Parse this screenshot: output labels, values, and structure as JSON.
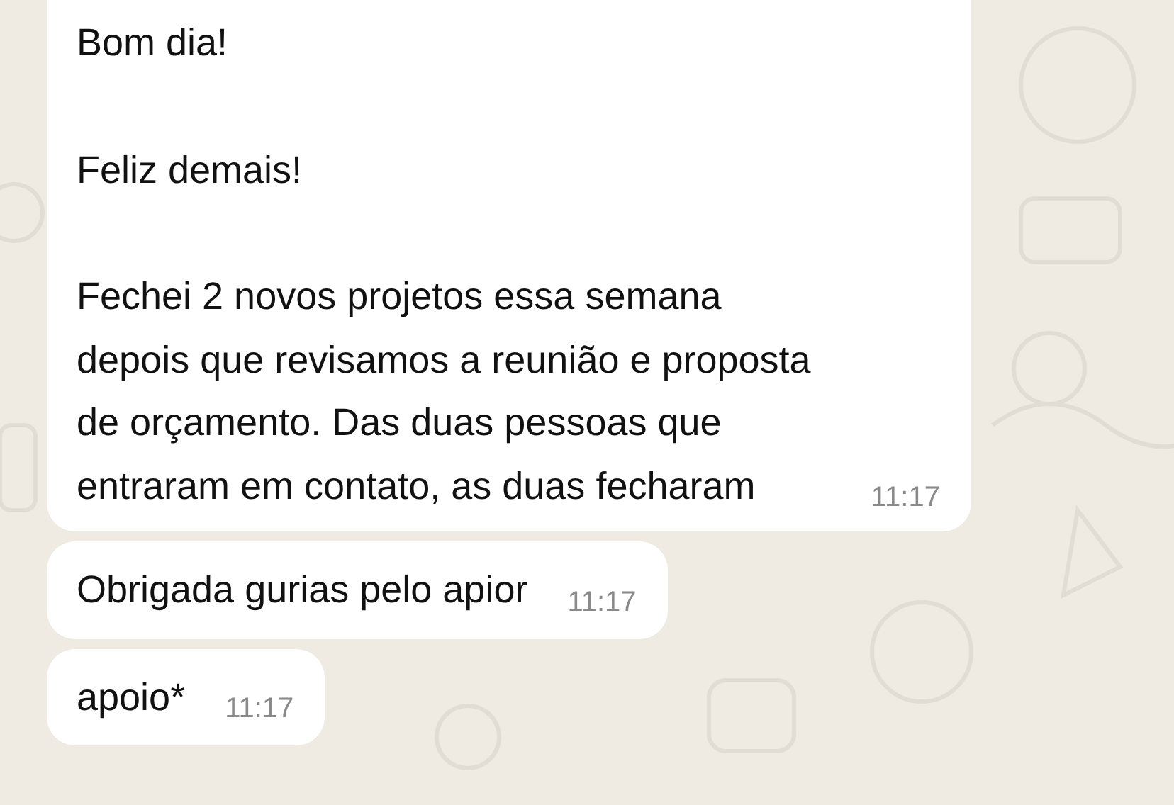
{
  "messages": [
    {
      "paragraphs": [
        "Bom dia!",
        "Feliz demais!",
        "Fechei 2 novos projetos essa semana depois que revisamos a reunião e proposta de orçamento. Das duas pessoas que entraram em contato, as duas fecharam"
      ],
      "time": "11:17"
    },
    {
      "paragraphs": [
        "Obrigada gurias pelo apior"
      ],
      "time": "11:17"
    },
    {
      "paragraphs": [
        "apoio*"
      ],
      "time": "11:17"
    }
  ]
}
